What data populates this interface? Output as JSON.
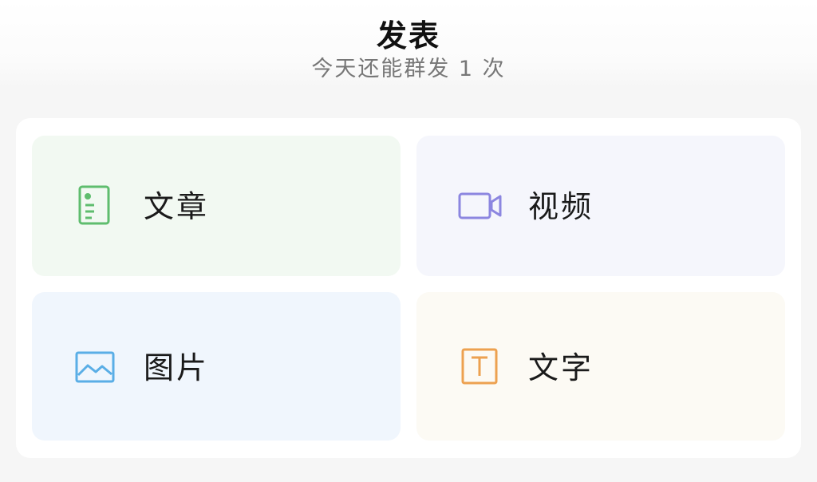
{
  "header": {
    "title": "发表",
    "subtitle": "今天还能群发 1 次"
  },
  "options": {
    "article": {
      "label": "文章",
      "icon": "document-icon",
      "color": "#5fbd6e"
    },
    "video": {
      "label": "视频",
      "icon": "video-camera-icon",
      "color": "#8c86e0"
    },
    "image": {
      "label": "图片",
      "icon": "picture-icon",
      "color": "#5aaee6"
    },
    "text": {
      "label": "文字",
      "icon": "text-t-icon",
      "color": "#eda150"
    }
  },
  "colors": {
    "article_bg": "#f2f9f2",
    "video_bg": "#f5f6fc",
    "image_bg": "#f0f6fd",
    "text_bg": "#fcfaf4"
  }
}
